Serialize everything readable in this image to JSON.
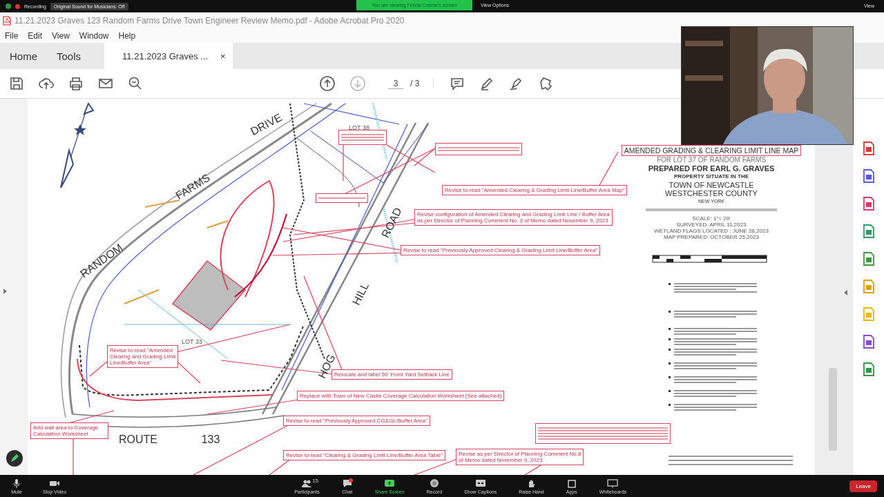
{
  "meeting_bar": {
    "recording": "Recording",
    "audio_notice": "Original Sound for Musicians: Off",
    "viewing_banner": "You are viewing Felicia Cosme's screen",
    "view_options": "View Options",
    "view": "View"
  },
  "window": {
    "title": "11.21.2023 Graves 123 Random Farms Drive Town Engineer Review Memo.pdf - Adobe Acrobat Pro 2020"
  },
  "menu": [
    "File",
    "Edit",
    "View",
    "Window",
    "Help"
  ],
  "tabs": [
    {
      "label": "Home",
      "selected": false,
      "kind": "nav"
    },
    {
      "label": "Tools",
      "selected": false,
      "kind": "nav"
    },
    {
      "label": "11.21.2023 Graves ...",
      "selected": true,
      "kind": "document",
      "close": "×"
    }
  ],
  "toolbar": {
    "page": "3",
    "page_total": "/ 3",
    "page_nav": [
      {
        "kind": "up",
        "disabled": false
      },
      {
        "kind": "down",
        "disabled": true
      }
    ]
  },
  "document": {
    "map_labels": [
      {
        "text": "DRIVE",
        "kind": "road"
      },
      {
        "text": "FARMS",
        "kind": "road"
      },
      {
        "text": "RANDOM",
        "kind": "road"
      },
      {
        "text": "ROAD",
        "kind": "road"
      },
      {
        "text": "HILL",
        "kind": "road"
      },
      {
        "text": "HOG",
        "kind": "road"
      },
      {
        "text": "ROUTE",
        "kind": "road"
      },
      {
        "text": "133",
        "kind": "road"
      },
      {
        "text": "LOT 38",
        "kind": "lot"
      },
      {
        "text": "LOT 33",
        "kind": "lot"
      }
    ],
    "annotations": [
      {
        "kind": "blurred"
      },
      {
        "kind": "blurred"
      },
      {
        "kind": "blurred"
      },
      {
        "kind": "text",
        "text": "Revise to read \"Amended Clearing & Grading Limit Line/Buffer Area Map\""
      },
      {
        "kind": "text",
        "text": "Revise configuration of Amended Clearing and Grading Limit Line / Buffer Area\nas per Director of Planning Comment No. 3 of Memo dated November 9, 2023"
      },
      {
        "kind": "text",
        "text": "Revise to read \"Previously Approved Clearing & Grading Limit Line/Buffer Area\""
      },
      {
        "kind": "text",
        "text": "Revise to read \"Amended\nClearing and Grading Limit\nLine/Buffer Area\""
      },
      {
        "kind": "text",
        "text": "Relocate and label 50' Front Yard Setback Line"
      },
      {
        "kind": "text",
        "text": "Replace with Town of New Castle Coverage Calculation Worksheet (See attached)"
      },
      {
        "kind": "text",
        "text": "Add wall area to Coverage Calculation Worksheet"
      },
      {
        "kind": "text",
        "text": "Revise to read \"Previously Approved CG&GL/Buffer Area\""
      },
      {
        "kind": "text",
        "text": "Revise to read \"Clearing & Grading Limit Line/Buffer Area Table\""
      },
      {
        "kind": "text",
        "text": "Revise as per Director of Planning Comment No.8\nof Memo dated November 9, 2023"
      },
      {
        "kind": "blurred"
      }
    ],
    "title_block": {
      "lines": [
        "AMENDED GRADING & CLEARING LIMIT LINE MAP",
        "FOR LOT 37 OF RANDOM FARMS",
        "PREPARED FOR  EARL G. GRAVES",
        "PROPERTY SITUATE IN THE",
        "TOWN OF NEWCASTLE",
        "WESTCHESTER  COUNTY",
        "NEW YORK"
      ],
      "details": [
        "SCALE: 1\"= 20'",
        "SURVEYED: APRIL 11,2023",
        "WETLAND FLAGS LOCATED : JUNE 28,2023",
        "MAP PREPARED: OCTOBER 25,2023"
      ]
    }
  },
  "controls": [
    {
      "label": "Mute",
      "kind": "mic"
    },
    {
      "label": "Stop Video",
      "kind": "camera"
    },
    {
      "label": "Participants",
      "kind": "people",
      "count": "15"
    },
    {
      "label": "Chat",
      "kind": "chat"
    },
    {
      "label": "Share Screen",
      "kind": "share"
    },
    {
      "label": "Record",
      "kind": "record"
    },
    {
      "label": "Show Captions",
      "kind": "cc"
    },
    {
      "label": "Raise Hand",
      "kind": "hand"
    },
    {
      "label": "Apps",
      "kind": "apps"
    },
    {
      "label": "Whiteboards",
      "kind": "board"
    },
    {
      "label": "Leave",
      "kind": "leave"
    }
  ]
}
